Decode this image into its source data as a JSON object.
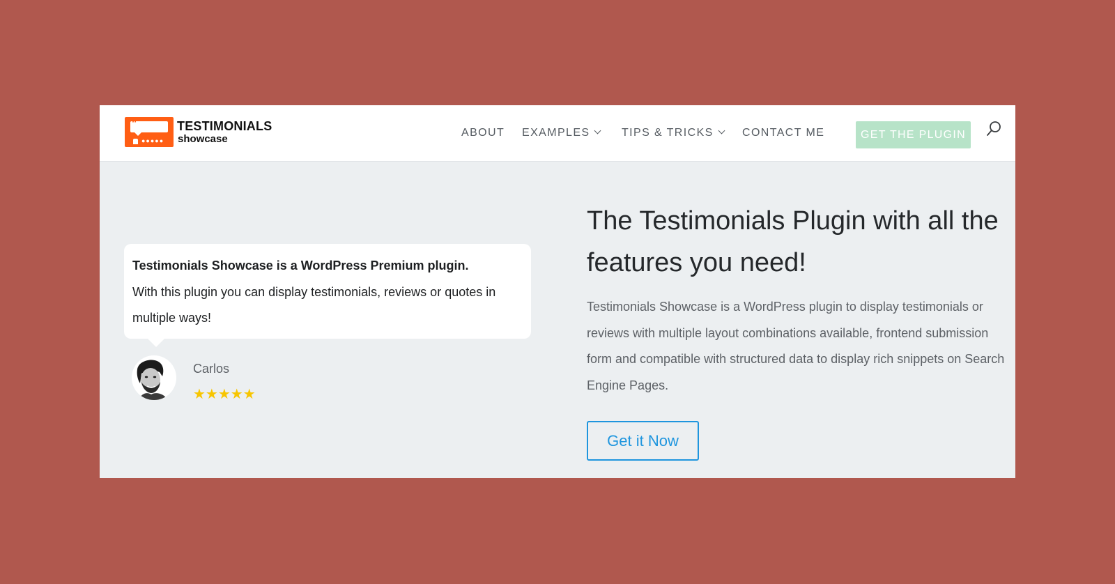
{
  "brand": {
    "title": "TESTIMONIALS",
    "subtitle": "showcase",
    "logo_color": "#ff5e14"
  },
  "nav": {
    "items": [
      {
        "label": "ABOUT",
        "has_dropdown": false
      },
      {
        "label": "EXAMPLES",
        "has_dropdown": true
      },
      {
        "label": "TIPS & TRICKS",
        "has_dropdown": true
      },
      {
        "label": "CONTACT ME",
        "has_dropdown": false
      }
    ],
    "cta_label": "GET THE PLUGIN",
    "cta_color": "#b7e3c8",
    "search_icon": "search-icon"
  },
  "testimonial": {
    "line1": "Testimonials Showcase is a WordPress Premium plugin.",
    "line2": "With this plugin you can display testimonials, reviews or quotes in multiple ways!",
    "author": "Carlos",
    "rating": 5,
    "stars": "★★★★★",
    "star_color": "#f7c500"
  },
  "hero": {
    "headline": "The Testimonials Plugin with all the features you need!",
    "description": "Testimonials Showcase is a WordPress plugin to display testimonials or reviews with multiple layout combinations available, frontend submission form and compatible with structured data to display rich snippets on Search Engine Pages.",
    "button_label": "Get it Now",
    "button_color": "#1e95de"
  },
  "colors": {
    "outer_background": "#b0584e",
    "hero_background": "#eceff1"
  }
}
